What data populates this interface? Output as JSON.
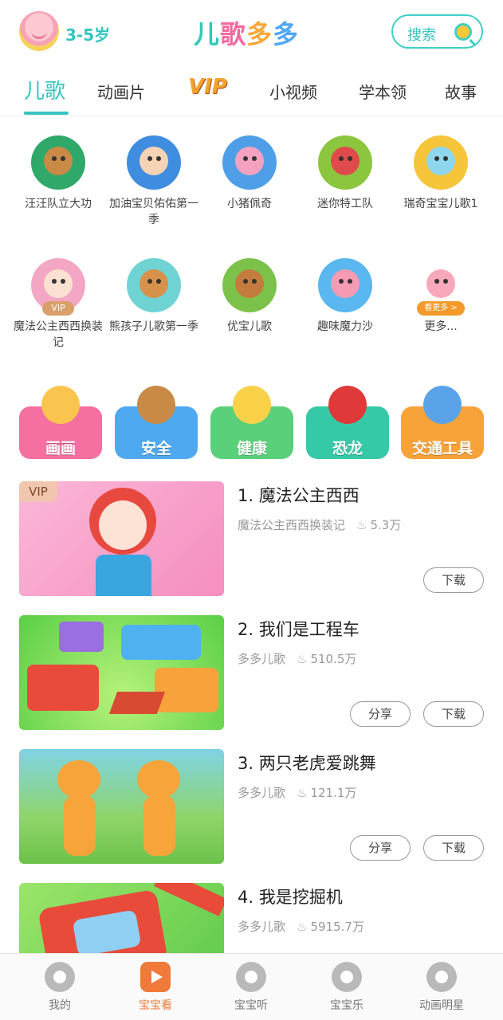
{
  "header": {
    "age_range": "3-5岁",
    "logo_parts": [
      "儿",
      "歌",
      "多",
      "多"
    ],
    "search_label": "搜索"
  },
  "tabs": [
    {
      "label": "儿歌",
      "active": true
    },
    {
      "label": "动画片",
      "active": false
    },
    {
      "label": "VIP",
      "active": false
    },
    {
      "label": "小视频",
      "active": false
    },
    {
      "label": "学本领",
      "active": false
    },
    {
      "label": "故事",
      "active": false
    }
  ],
  "shows_row1": [
    {
      "label": "汪汪队立大功",
      "icon": "paw-patrol-dog"
    },
    {
      "label": "加油宝贝佑佑第一季",
      "icon": "baby-boy"
    },
    {
      "label": "小猪佩奇",
      "icon": "pink-pig"
    },
    {
      "label": "迷你特工队",
      "icon": "red-bird-robot"
    },
    {
      "label": "瑞奇宝宝儿歌1",
      "icon": "blue-bunny"
    }
  ],
  "shows_row2": [
    {
      "label": "魔法公主西西换装记",
      "icon": "princess",
      "tag": "VIP"
    },
    {
      "label": "熊孩子儿歌第一季",
      "icon": "bear-kid"
    },
    {
      "label": "优宝儿歌",
      "icon": "cat-kid"
    },
    {
      "label": "趣味魔力沙",
      "icon": "sand-pig"
    },
    {
      "label": "更多...",
      "icon": "more-pig",
      "tag": "看更多 >"
    }
  ],
  "categories": [
    {
      "label": "画画",
      "color": "#f56fa0",
      "icon": "painting-cat"
    },
    {
      "label": "安全",
      "color": "#4fa9f0",
      "icon": "police-monkey"
    },
    {
      "label": "健康",
      "color": "#5bd07a",
      "icon": "masked-duck"
    },
    {
      "label": "恐龙",
      "color": "#35c9a8",
      "icon": "red-dinosaur"
    },
    {
      "label": "交通工具",
      "color": "#f8a33a",
      "icon": "blue-car"
    }
  ],
  "videos": [
    {
      "title": "1. 魔法公主西西",
      "channel": "魔法公主西西换装记",
      "plays": "5.3万",
      "vip": "VIP",
      "buttons": [
        "下载"
      ],
      "theme": "princess"
    },
    {
      "title": "2. 我们是工程车",
      "channel": "多多儿歌",
      "plays": "510.5万",
      "buttons": [
        "分享",
        "下载"
      ],
      "theme": "trucks"
    },
    {
      "title": "3. 两只老虎爱跳舞",
      "channel": "多多儿歌",
      "plays": "121.1万",
      "buttons": [
        "分享",
        "下载"
      ],
      "theme": "tigers"
    },
    {
      "title": "4. 我是挖掘机",
      "channel": "多多儿歌",
      "plays": "5915.7万",
      "buttons": [],
      "theme": "excavator"
    }
  ],
  "bottom_nav": [
    {
      "label": "我的",
      "icon": "monkey-icon",
      "active": false
    },
    {
      "label": "宝宝看",
      "icon": "play-tv-icon",
      "active": true
    },
    {
      "label": "宝宝听",
      "icon": "headphones-icon",
      "active": false
    },
    {
      "label": "宝宝乐",
      "icon": "puzzle-icon",
      "active": false
    },
    {
      "label": "动画明星",
      "icon": "bear-star-icon",
      "active": false
    }
  ],
  "colors": {
    "accent": "#36c4bf",
    "active_nav": "#f07a3a"
  }
}
